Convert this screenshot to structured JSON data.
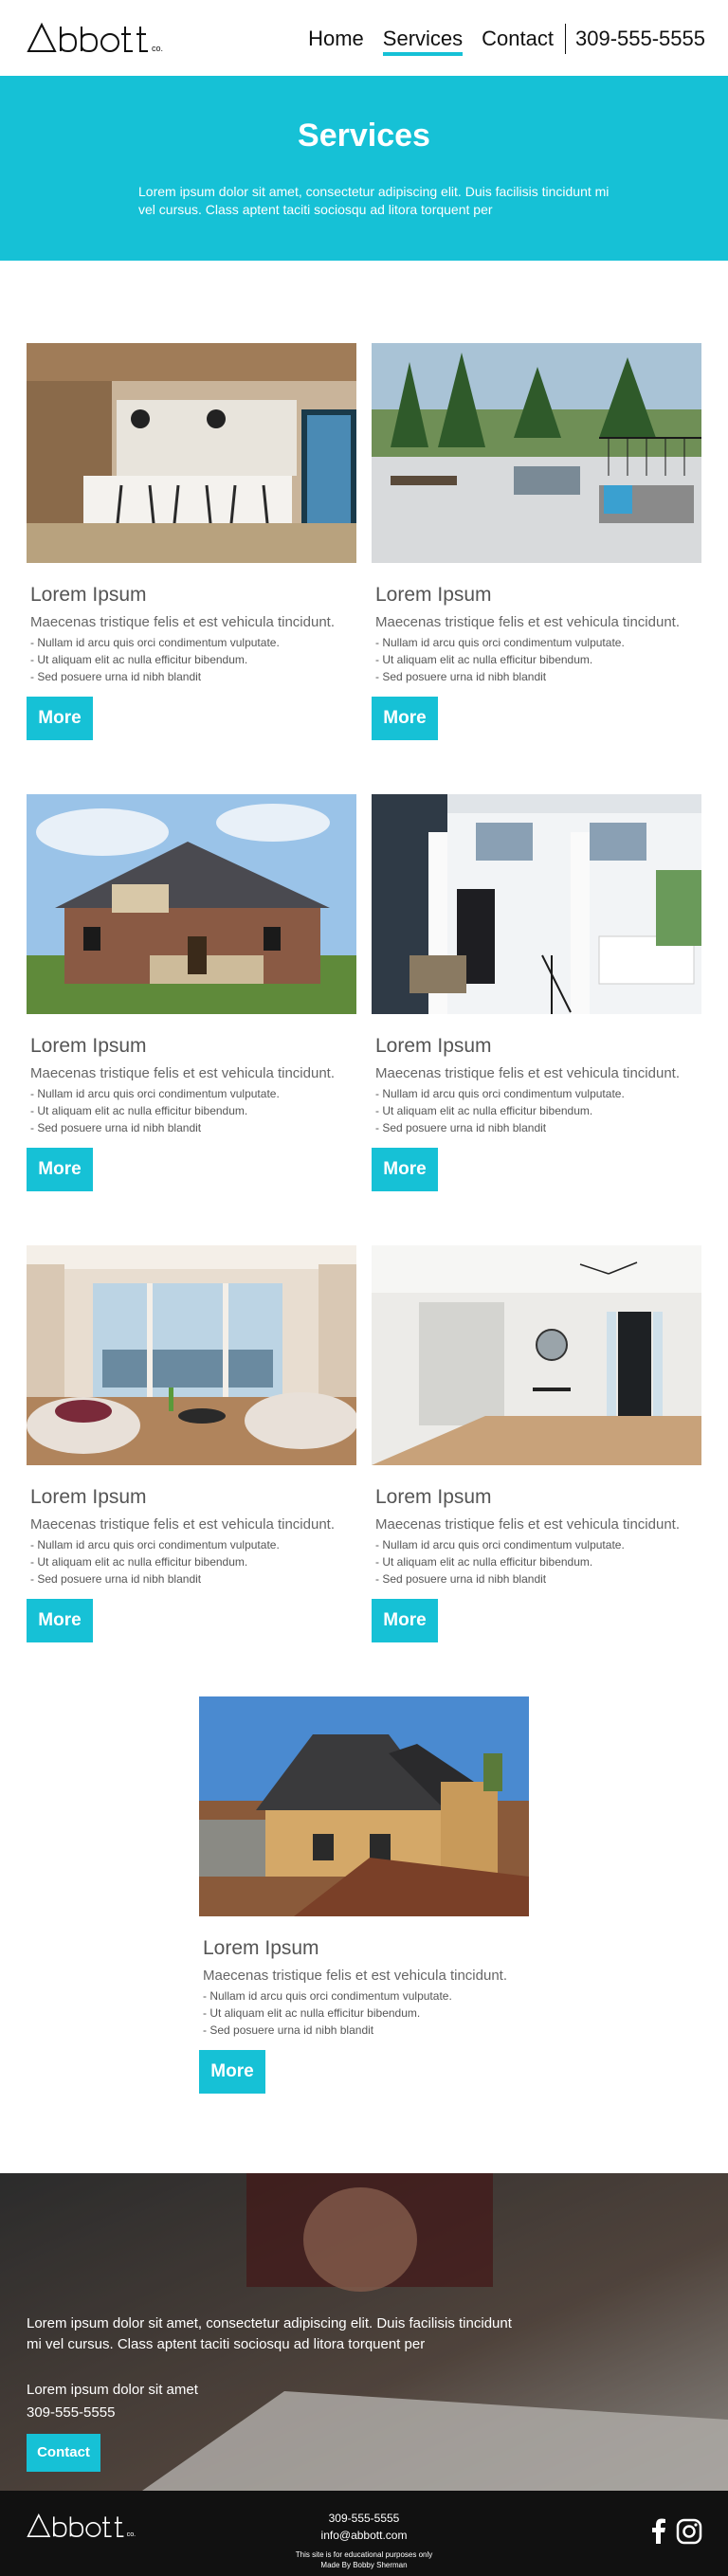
{
  "header": {
    "logo_text": "Abbott",
    "logo_suffix": "co.",
    "nav": [
      {
        "label": "Home"
      },
      {
        "label": "Services"
      },
      {
        "label": "Contact"
      }
    ],
    "phone": "309-555-5555"
  },
  "hero": {
    "title": "Services",
    "text": "Lorem ipsum dolor sit amet, consectetur adipiscing elit. Duis facilisis tincidunt mi vel cursus. Class aptent taciti sociosqu ad litora torquent per"
  },
  "services": [
    {
      "title": "Lorem Ipsum",
      "subtitle": "Maecenas tristique felis et est vehicula tincidunt.",
      "bullets": [
        "- Nullam id arcu quis orci condimentum vulputate.",
        "- Ut aliquam elit ac nulla efficitur bibendum.",
        "- Sed posuere urna id nibh blandit"
      ],
      "button": "More",
      "image": "kitchen-photo"
    },
    {
      "title": "Lorem Ipsum",
      "subtitle": "Maecenas tristique felis et est vehicula tincidunt.",
      "bullets": [
        "- Nullam id arcu quis orci condimentum vulputate.",
        "- Ut aliquam elit ac nulla efficitur bibendum.",
        "- Sed posuere urna id nibh blandit"
      ],
      "button": "More",
      "image": "deck-photo"
    },
    {
      "title": "Lorem Ipsum",
      "subtitle": "Maecenas tristique felis et est vehicula tincidunt.",
      "bullets": [
        "- Nullam id arcu quis orci condimentum vulputate.",
        "- Ut aliquam elit ac nulla efficitur bibendum.",
        "- Sed posuere urna id nibh blandit"
      ],
      "button": "More",
      "image": "house-photo"
    },
    {
      "title": "Lorem Ipsum",
      "subtitle": "Maecenas tristique felis et est vehicula tincidunt.",
      "bullets": [
        "- Nullam id arcu quis orci condimentum vulputate.",
        "- Ut aliquam elit ac nulla efficitur bibendum.",
        "- Sed posuere urna id nibh blandit"
      ],
      "button": "More",
      "image": "porch-photo"
    },
    {
      "title": "Lorem Ipsum",
      "subtitle": "Maecenas tristique felis et est vehicula tincidunt.",
      "bullets": [
        "- Nullam id arcu quis orci condimentum vulputate.",
        "- Ut aliquam elit ac nulla efficitur bibendum.",
        "- Sed posuere urna id nibh blandit"
      ],
      "button": "More",
      "image": "living-room-photo"
    },
    {
      "title": "Lorem Ipsum",
      "subtitle": "Maecenas tristique felis et est vehicula tincidunt.",
      "bullets": [
        "- Nullam id arcu quis orci condimentum vulputate.",
        "- Ut aliquam elit ac nulla efficitur bibendum.",
        "- Sed posuere urna id nibh blandit"
      ],
      "button": "More",
      "image": "entryway-photo"
    },
    {
      "title": "Lorem Ipsum",
      "subtitle": "Maecenas tristique felis et est vehicula tincidunt.",
      "bullets": [
        "- Nullam id arcu quis orci condimentum vulputate.",
        "- Ut aliquam elit ac nulla efficitur bibendum.",
        "- Sed posuere urna id nibh blandit"
      ],
      "button": "More",
      "image": "construction-photo"
    }
  ],
  "promo": {
    "text": "Lorem ipsum dolor sit amet, consectetur adipiscing elit. Duis facilisis tincidunt mi vel cursus. Class aptent taciti sociosqu ad litora torquent per",
    "line": "Lorem ipsum dolor sit amet",
    "phone": "309-555-5555",
    "button": "Contact"
  },
  "footer": {
    "phone": "309-555-5555",
    "email": "info@abbott.com",
    "note": "This site is for educational purposes only",
    "credit": "Made By Bobby Sherman",
    "social": [
      "facebook-icon",
      "instagram-icon"
    ]
  },
  "colors": {
    "accent": "#16c1d6",
    "footer": "#111111"
  }
}
